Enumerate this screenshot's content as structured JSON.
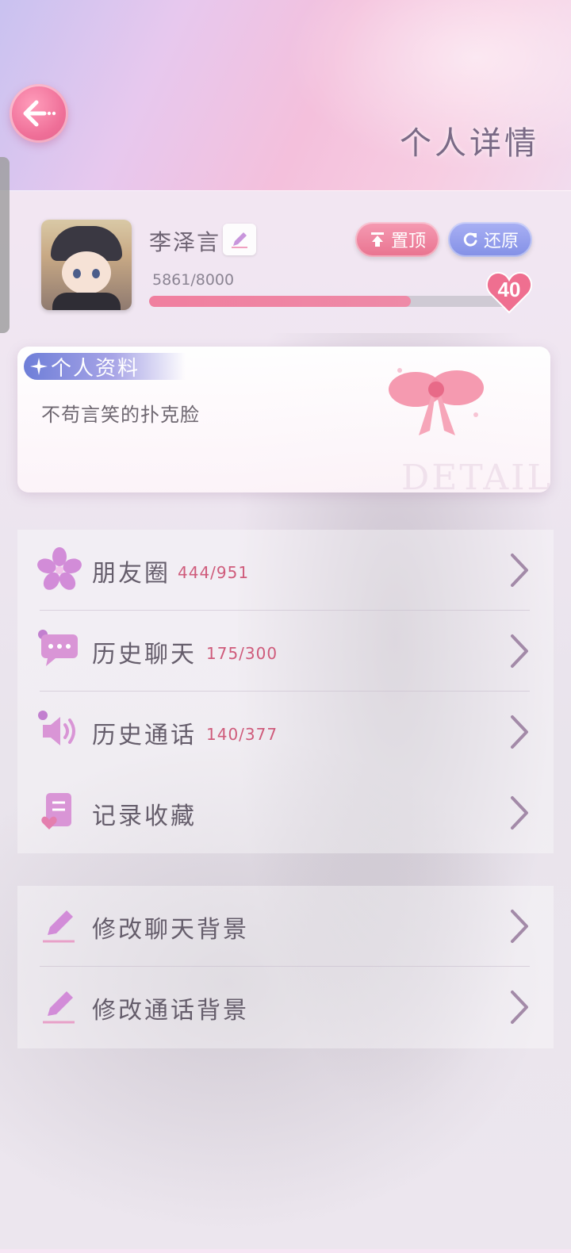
{
  "header": {
    "title": "个人详情"
  },
  "profile": {
    "name": "李泽言",
    "pin_label": "置顶",
    "restore_label": "还原",
    "progress_text": "5861/8000",
    "progress_fraction": 0.7326,
    "level": "40"
  },
  "bio": {
    "tag": "个人资料",
    "text": "不苟言笑的扑克脸",
    "watermark": "DETAIL"
  },
  "menu": [
    {
      "label": "朋友圈",
      "count": "444/951",
      "icon": "sakura-icon"
    },
    {
      "label": "历史聊天",
      "count": "175/300",
      "icon": "chat-bubble-icon"
    },
    {
      "label": "历史通话",
      "count": "140/377",
      "icon": "speaker-icon"
    },
    {
      "label": "记录收藏",
      "count": "",
      "icon": "bookmark-heart-icon"
    }
  ],
  "settings": [
    {
      "label": "修改聊天背景",
      "icon": "pencil-icon"
    },
    {
      "label": "修改通话背景",
      "icon": "pencil-icon"
    }
  ],
  "colors": {
    "accent_pink": "#e9738f",
    "accent_blue": "#8390e6",
    "count_red": "#cf5b7b"
  }
}
